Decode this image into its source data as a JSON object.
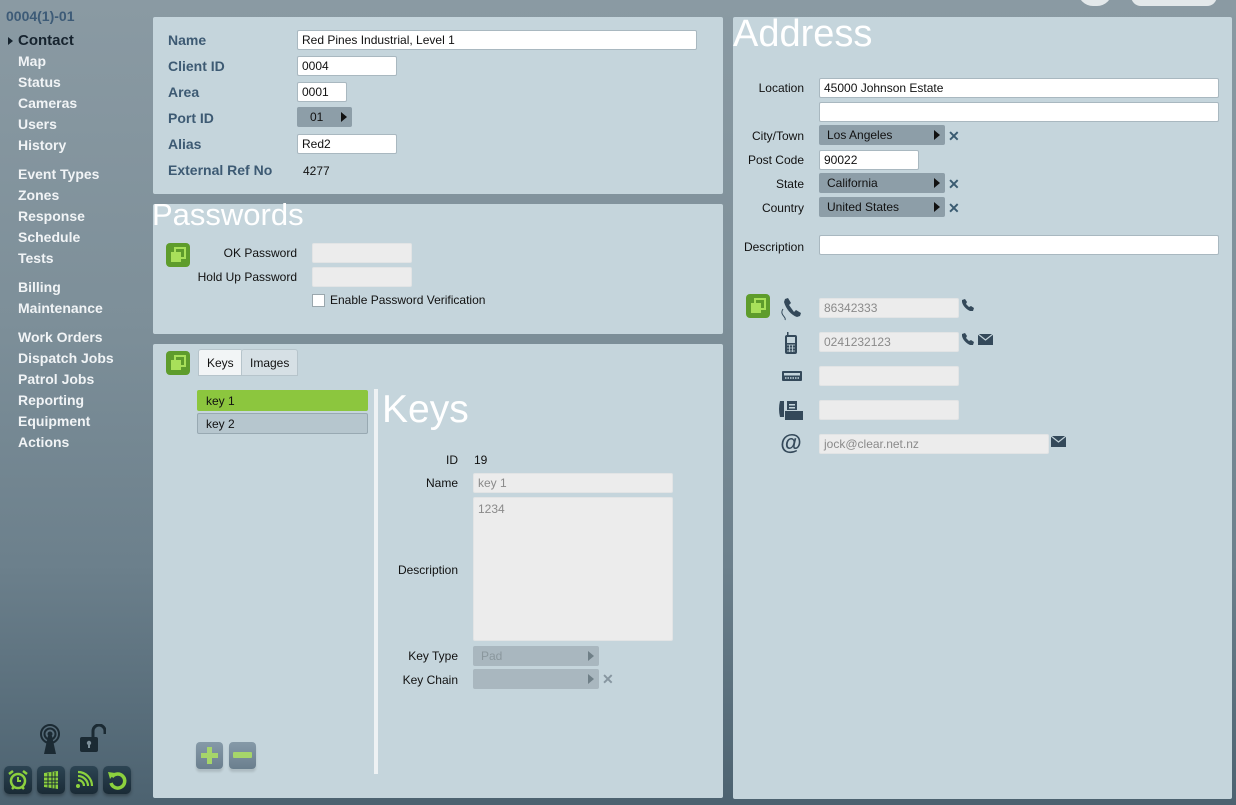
{
  "sidebar": {
    "title": "0004(1)-01",
    "groups": [
      [
        {
          "label": "Contact",
          "active": true
        },
        {
          "label": "Map"
        },
        {
          "label": "Status"
        },
        {
          "label": "Cameras"
        },
        {
          "label": "Users"
        },
        {
          "label": "History"
        }
      ],
      [
        {
          "label": "Event Types"
        },
        {
          "label": "Zones"
        },
        {
          "label": "Response"
        },
        {
          "label": "Schedule"
        },
        {
          "label": "Tests"
        }
      ],
      [
        {
          "label": "Billing"
        },
        {
          "label": "Maintenance"
        }
      ],
      [
        {
          "label": "Work Orders"
        },
        {
          "label": "Dispatch Jobs"
        },
        {
          "label": "Patrol Jobs"
        },
        {
          "label": "Reporting"
        },
        {
          "label": "Equipment"
        },
        {
          "label": "Actions"
        }
      ]
    ],
    "status_icons": [
      "signal-tower-icon",
      "unlocked-padlock-icon"
    ],
    "quick_buttons": [
      "alarm-clock-icon",
      "building-icon",
      "wireless-icon",
      "refresh-icon"
    ]
  },
  "general": {
    "name_label": "Name",
    "name_value": "Red Pines Industrial, Level 1",
    "client_id_label": "Client ID",
    "client_id_value": "0004",
    "area_label": "Area",
    "area_value": "0001",
    "port_id_label": "Port ID",
    "port_id_value": "01",
    "alias_label": "Alias",
    "alias_value": "Red2",
    "ext_ref_label": "External Ref No",
    "ext_ref_value": "4277"
  },
  "passwords": {
    "title": "Passwords",
    "ok_label": "OK Password",
    "ok_value": "",
    "holdup_label": "Hold Up Password",
    "holdup_value": "",
    "verify_label": "Enable Password Verification",
    "verify_checked": false
  },
  "keys_panel": {
    "tabs": [
      {
        "label": "Keys",
        "active": true
      },
      {
        "label": "Images",
        "active": false
      }
    ],
    "list": [
      {
        "label": "key 1",
        "selected": true
      },
      {
        "label": "key 2",
        "selected": false
      }
    ],
    "detail": {
      "title": "Keys",
      "id_label": "ID",
      "id_value": "19",
      "name_label": "Name",
      "name_value": "key 1",
      "desc_label": "Description",
      "desc_value": "1234",
      "type_label": "Key Type",
      "type_value": "Pad",
      "chain_label": "Key Chain",
      "chain_value": ""
    }
  },
  "address": {
    "title": "Address",
    "location_label": "Location",
    "location_value": "45000 Johnson Estate",
    "location2_value": "",
    "city_label": "City/Town",
    "city_value": "Los Angeles",
    "postcode_label": "Post Code",
    "postcode_value": "90022",
    "state_label": "State",
    "state_value": "California",
    "country_label": "Country",
    "country_value": "United States",
    "description_label": "Description",
    "description_value": ""
  },
  "contacts": {
    "phone": "86342333",
    "mobile": "0241232123",
    "pager": "",
    "fax": "",
    "email": "jock@clear.net.nz"
  },
  "colors": {
    "accent_green": "#8cc63e",
    "label_blue": "#3d5a73",
    "panel_bg": "#c5d5dc"
  }
}
